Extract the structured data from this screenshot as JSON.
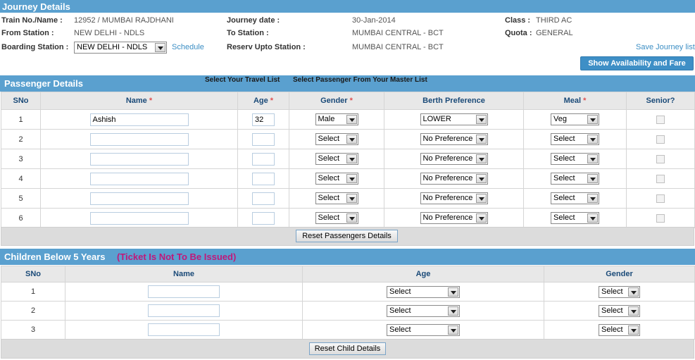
{
  "journey": {
    "title": "Journey Details",
    "train_label": "Train No./Name :",
    "train_value": "12952 / MUMBAI RAJDHANI",
    "from_label": "From Station :",
    "from_value": "NEW DELHI - NDLS",
    "boarding_label": "Boarding Station :",
    "boarding_value": "NEW DELHI - NDLS",
    "schedule_link": "Schedule",
    "date_label": "Journey date :",
    "date_value": "30-Jan-2014",
    "to_label": "To Station :",
    "to_value": "MUMBAI CENTRAL - BCT",
    "reserv_label": "Reserv Upto Station :",
    "reserv_value": "MUMBAI CENTRAL - BCT",
    "class_label": "Class :",
    "class_value": "THIRD AC",
    "quota_label": "Quota :",
    "quota_value": "GENERAL",
    "save_link": "Save Journey list",
    "show_button": "Show Availability and Fare"
  },
  "passengers": {
    "title": "Passenger Details",
    "travel_list_link": "Select Your Travel List",
    "master_list_link": "Select Passenger From Your Master List",
    "headers": {
      "sno": "SNo",
      "name": "Name",
      "age": "Age",
      "gender": "Gender",
      "berth": "Berth Preference",
      "meal": "Meal",
      "senior": "Senior?"
    },
    "required_mark": "*",
    "rows": [
      {
        "sno": "1",
        "name": "Ashish",
        "age": "32",
        "gender": "Male",
        "berth": "LOWER",
        "meal": "Veg"
      },
      {
        "sno": "2",
        "name": "",
        "age": "",
        "gender": "Select",
        "berth": "No Preference",
        "meal": "Select"
      },
      {
        "sno": "3",
        "name": "",
        "age": "",
        "gender": "Select",
        "berth": "No Preference",
        "meal": "Select"
      },
      {
        "sno": "4",
        "name": "",
        "age": "",
        "gender": "Select",
        "berth": "No Preference",
        "meal": "Select"
      },
      {
        "sno": "5",
        "name": "",
        "age": "",
        "gender": "Select",
        "berth": "No Preference",
        "meal": "Select"
      },
      {
        "sno": "6",
        "name": "",
        "age": "",
        "gender": "Select",
        "berth": "No Preference",
        "meal": "Select"
      }
    ],
    "reset_button": "Reset Passengers Details"
  },
  "children": {
    "title": "Children Below 5 Years",
    "note": "(Ticket Is Not To Be Issued)",
    "note_color": "#c0187a",
    "headers": {
      "sno": "SNo",
      "name": "Name",
      "age": "Age",
      "gender": "Gender"
    },
    "rows": [
      {
        "sno": "1",
        "name": "",
        "age": "Select",
        "gender": "Select"
      },
      {
        "sno": "2",
        "name": "",
        "age": "Select",
        "gender": "Select"
      },
      {
        "sno": "3",
        "name": "",
        "age": "Select",
        "gender": "Select"
      }
    ],
    "reset_button": "Reset Child Details"
  }
}
